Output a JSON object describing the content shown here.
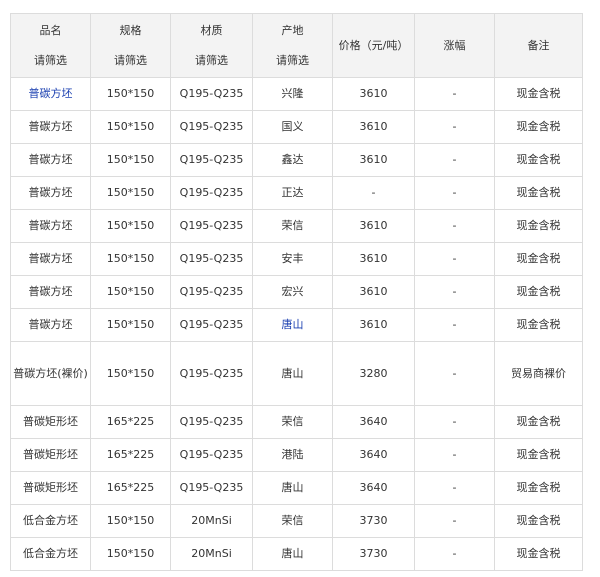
{
  "headers": {
    "name": "品名",
    "spec": "规格",
    "material": "材质",
    "origin": "产地",
    "price": "价格（元/吨）",
    "change": "涨幅",
    "note": "备注",
    "filter": "请筛选"
  },
  "rows": [
    {
      "name": "普碳方坯",
      "spec": "150*150",
      "material": "Q195-Q235",
      "origin": "兴隆",
      "price": "3610",
      "change": "-",
      "note": "现金含税"
    },
    {
      "name": "普碳方坯",
      "spec": "150*150",
      "material": "Q195-Q235",
      "origin": "国义",
      "price": "3610",
      "change": "-",
      "note": "现金含税"
    },
    {
      "name": "普碳方坯",
      "spec": "150*150",
      "material": "Q195-Q235",
      "origin": "鑫达",
      "price": "3610",
      "change": "-",
      "note": "现金含税"
    },
    {
      "name": "普碳方坯",
      "spec": "150*150",
      "material": "Q195-Q235",
      "origin": "正达",
      "price": "-",
      "change": "-",
      "note": "现金含税"
    },
    {
      "name": "普碳方坯",
      "spec": "150*150",
      "material": "Q195-Q235",
      "origin": "荣信",
      "price": "3610",
      "change": "-",
      "note": "现金含税"
    },
    {
      "name": "普碳方坯",
      "spec": "150*150",
      "material": "Q195-Q235",
      "origin": "安丰",
      "price": "3610",
      "change": "-",
      "note": "现金含税"
    },
    {
      "name": "普碳方坯",
      "spec": "150*150",
      "material": "Q195-Q235",
      "origin": "宏兴",
      "price": "3610",
      "change": "-",
      "note": "现金含税"
    },
    {
      "name": "普碳方坯",
      "spec": "150*150",
      "material": "Q195-Q235",
      "origin": "唐山",
      "price": "3610",
      "change": "-",
      "note": "现金含税"
    },
    {
      "name": "普碳方坯(裸价)",
      "spec": "150*150",
      "material": "Q195-Q235",
      "origin": "唐山",
      "price": "3280",
      "change": "-",
      "note": "贸易商裸价"
    },
    {
      "name": "普碳矩形坯",
      "spec": "165*225",
      "material": "Q195-Q235",
      "origin": "荣信",
      "price": "3640",
      "change": "-",
      "note": "现金含税"
    },
    {
      "name": "普碳矩形坯",
      "spec": "165*225",
      "material": "Q195-Q235",
      "origin": "港陆",
      "price": "3640",
      "change": "-",
      "note": "现金含税"
    },
    {
      "name": "普碳矩形坯",
      "spec": "165*225",
      "material": "Q195-Q235",
      "origin": "唐山",
      "price": "3640",
      "change": "-",
      "note": "现金含税"
    },
    {
      "name": "低合金方坯",
      "spec": "150*150",
      "material": "20MnSi",
      "origin": "荣信",
      "price": "3730",
      "change": "-",
      "note": "现金含税"
    },
    {
      "name": "低合金方坯",
      "spec": "150*150",
      "material": "20MnSi",
      "origin": "唐山",
      "price": "3730",
      "change": "-",
      "note": "现金含税"
    }
  ]
}
